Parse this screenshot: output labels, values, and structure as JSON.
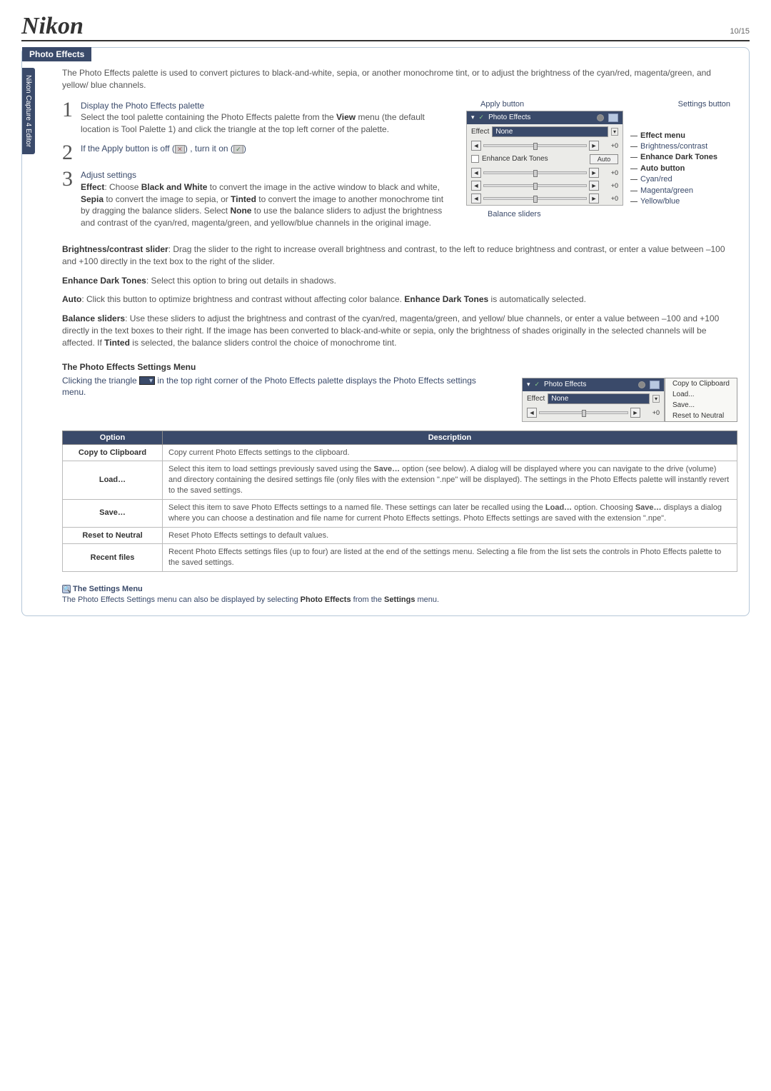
{
  "brand": "Nikon",
  "page_number": "10/15",
  "side_tab": "Nikon Capture 4 Editor",
  "section_title": "Photo Effects",
  "intro": "The Photo Effects palette is used to convert pictures to black-and-white, sepia, or another monochrome tint, or to adjust the brightness of the cyan/red, magenta/green, and yellow/ blue channels.",
  "step1": {
    "title": "Display the Photo Effects palette",
    "body_a": "Select the tool palette containing the Photo Effects palette from the ",
    "view": "View",
    "body_b": " menu (the default location is Tool Palette 1) and click the triangle at the top left corner of the palette."
  },
  "step2": {
    "title_a": "If the Apply button is off (",
    "off_icon": "✕",
    "title_b": ") , turn it on (",
    "on_icon": "✓",
    "title_c": ")"
  },
  "step3": {
    "title": "Adjust settings",
    "body_a": "Effect",
    "body_b": ": Choose ",
    "bw": "Black and White",
    "body_c": " to convert the image in the active window to black and white, ",
    "sepia": "Sepia",
    "body_d": " to convert the image to sepia, or ",
    "tinted": "Tinted",
    "body_e": " to convert the image to another monochrome tint by dragging the balance sliders. Select ",
    "none": "None",
    "body_f": " to use the balance sliders to adjust the brightness and contrast of the cyan/red, magenta/green, and yellow/blue channels in the original image."
  },
  "para_bc": {
    "lead": "Brightness/contrast slider",
    "text": ": Drag the slider to the right to increase overall brightness and contrast, to the left to reduce brightness and contrast, or enter a value between –100 and +100 directly in the text box to the right of the slider."
  },
  "para_dark": {
    "lead": "Enhance Dark Tones",
    "text": ": Select this option to bring out details in shadows."
  },
  "para_auto": {
    "lead": "Auto",
    "text_a": ": Click this button to optimize brightness and contrast without affecting color balance.  ",
    "dark": "Enhance Dark Tones",
    "text_b": " is automatically selected."
  },
  "para_bal": {
    "lead": "Balance sliders",
    "text_a": ": Use these sliders to adjust the brightness and contrast of the cyan/red, magenta/green, and yellow/ blue channels, or enter a value between –100 and +100 directly in the text boxes to their right. If the image has been converted to black-and-white or sepia, only the brightness of shades originally in the selected channels will be affected.  If ",
    "tinted": "Tinted",
    "text_b": " is selected, the balance sliders control the choice of monochrome tint."
  },
  "diagram": {
    "apply_btn_label": "Apply button",
    "settings_btn_label": "Settings button",
    "pal_title": "Photo Effects",
    "effect_label": "Effect",
    "effect_value": "None",
    "enhance_label": "Enhance Dark Tones",
    "auto_label": "Auto",
    "slider_val": "+0",
    "labels": {
      "effect_menu": "Effect menu",
      "bc": "Brightness/contrast",
      "dark": "Enhance Dark Tones",
      "auto": "Auto button",
      "cyan": "Cyan/red",
      "magenta": "Magenta/green",
      "yellow": "Yellow/blue"
    },
    "balance_label": "Balance sliders"
  },
  "settings_menu_section": {
    "title": "The Photo Effects Settings Menu",
    "intro_a": "Clicking the triangle ",
    "intro_b": " in the top right corner of the Photo Effects palette displays the Photo Effects settings menu.",
    "menu_items": [
      "Copy to Clipboard",
      "Load...",
      "Save...",
      "Reset to Neutral"
    ]
  },
  "table": {
    "head_option": "Option",
    "head_desc": "Description",
    "rows": [
      {
        "opt": "Copy to Clipboard",
        "desc": "Copy current Photo Effects settings to the clipboard."
      },
      {
        "opt": "Load…",
        "desc": "Select this item to load settings previously saved using the <b>Save…</b> option (see below).  A dialog will be displayed where you can navigate to the drive (volume) and directory containing the desired settings file (only files with the extension \".npe\" will be displayed).  The settings in the Photo Effects palette will instantly revert to the saved settings."
      },
      {
        "opt": "Save…",
        "desc": "Select this item to save Photo Effects settings to a named file.  These settings can later be recalled using the <b>Load…</b> option. Choosing <b>Save…</b> displays a dialog where you can choose a destination and file name for current Photo Effects settings. Photo Effects settings are saved with the extension \".npe\"."
      },
      {
        "opt": "Reset to Neutral",
        "desc": "Reset Photo Effects settings to default values."
      },
      {
        "opt": "Recent files",
        "desc": "Recent Photo Effects settings files (up to four) are listed at the end of the settings menu.  Selecting a file from the list sets the controls in Photo Effects palette to the saved settings."
      }
    ]
  },
  "footnote": {
    "title": "The Settings Menu",
    "text_a": "The Photo Effects Settings menu can also be displayed by selecting ",
    "pe": "Photo Effects",
    "text_b": " from the ",
    "settings": "Settings",
    "text_c": " menu."
  }
}
